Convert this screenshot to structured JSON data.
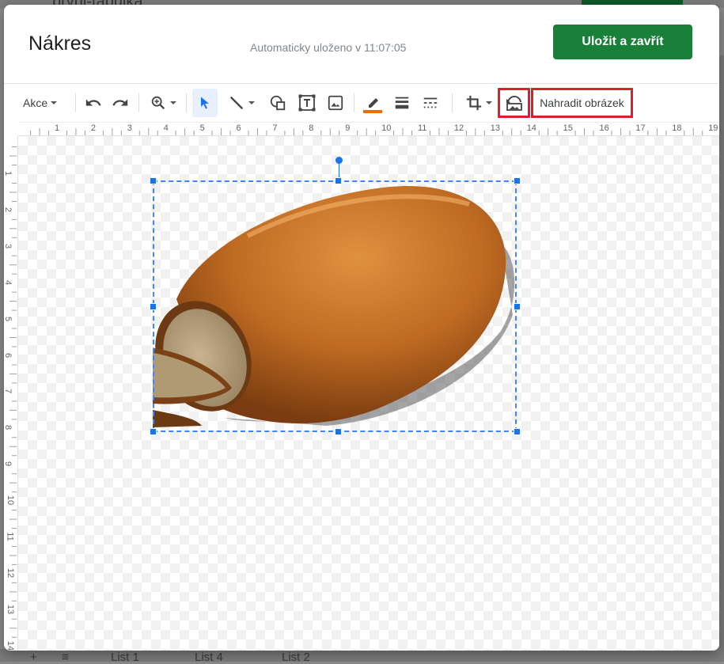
{
  "background": {
    "sheet_title": "prvni-tabulka",
    "sheet_tabs": [
      "List 1",
      "List 4",
      "List 2"
    ]
  },
  "dialog": {
    "title": "Nákres",
    "autosave_status": "Automaticky uloženo v 11:07:05",
    "save_button_label": "Uložit a zavřít"
  },
  "toolbar": {
    "actions_menu_label": "Akce",
    "replace_image_label": "Nahradit obrázek",
    "icons": [
      "undo-icon",
      "redo-icon",
      "zoom-icon",
      "select-icon",
      "line-icon",
      "shape-icon",
      "text-box-icon",
      "image-icon",
      "border-color-icon",
      "border-weight-icon",
      "border-dash-icon",
      "crop-icon",
      "replace-image-icon"
    ],
    "border_color": "#e8710a"
  },
  "ruler": {
    "horizontal": [
      "1",
      "2",
      "3",
      "4",
      "5",
      "6",
      "7",
      "8",
      "9",
      "10",
      "11",
      "12",
      "13",
      "14",
      "15",
      "16",
      "17",
      "18",
      "19"
    ],
    "vertical": [
      "1",
      "2",
      "3",
      "4",
      "5",
      "6",
      "7",
      "8",
      "9",
      "10",
      "11",
      "12",
      "13",
      "14"
    ]
  },
  "colors": {
    "save_green": "#188038",
    "selection_blue": "#1a73e8",
    "highlight_red": "#e01e2b"
  }
}
